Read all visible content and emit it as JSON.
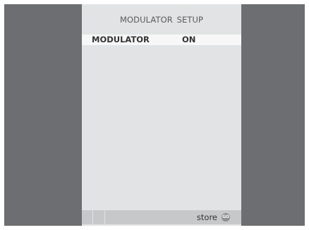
{
  "menu": {
    "title": "MODULATOR SETUP",
    "rows": [
      {
        "label": "MODULATOR",
        "value": "ON"
      }
    ]
  },
  "status_bar": {
    "store_label": "store",
    "go_button_label": "GO"
  },
  "colors": {
    "frame": "#6d6e71",
    "panel": "#e2e3e4",
    "highlight_row": "#f7f7f7",
    "status_bar": "#c7c8ca",
    "text": "#333335"
  }
}
